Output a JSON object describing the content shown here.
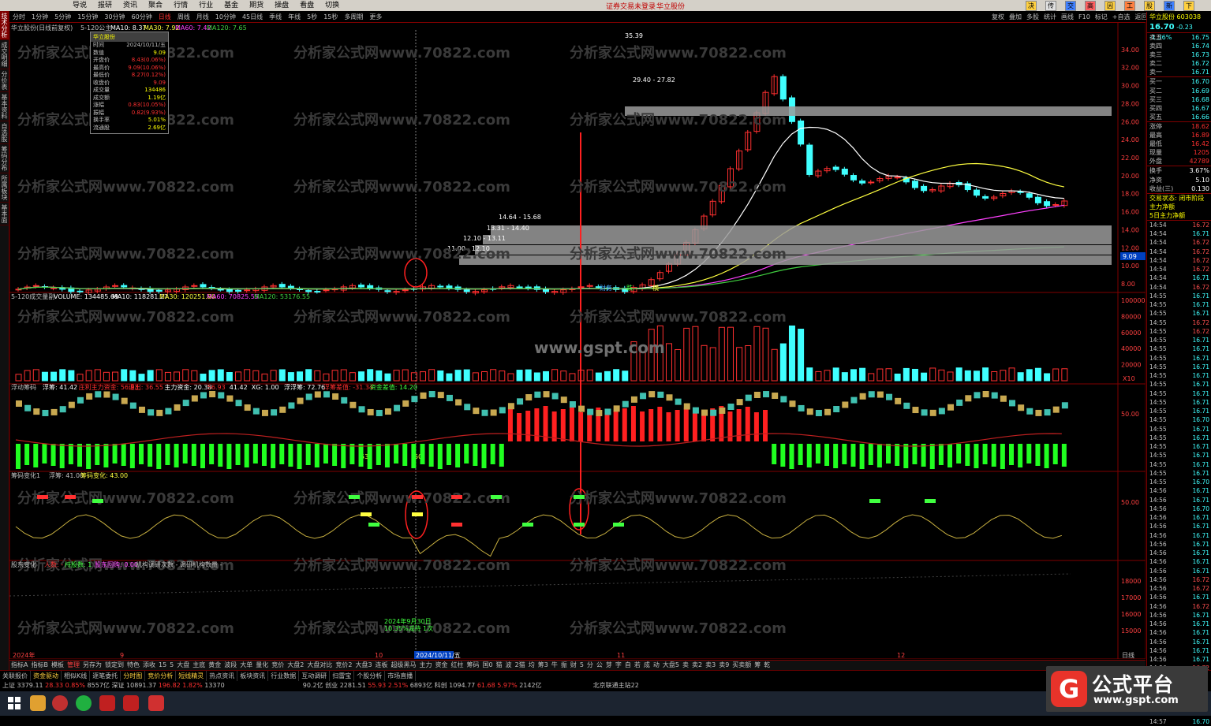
{
  "menu": {
    "items": [
      "分时",
      "1分钟",
      "5分钟",
      "15分钟",
      "30分钟",
      "60分钟",
      "日线",
      "周线",
      "月线",
      "10分钟",
      "45日线",
      "季线",
      "年线",
      "5秒",
      "15秒",
      "多周期",
      "更多"
    ],
    "top_items": [
      "导说",
      "报研",
      "资讯",
      "聚合",
      "行情",
      "行业",
      "基金",
      "期货",
      "操盘",
      "看盘",
      "切换"
    ],
    "notice1": "证券交易未登录",
    "notice2": "华立股份",
    "right_buttons": [
      "决策",
      "传统",
      "交易",
      "高点",
      "因子",
      "工具",
      "股池",
      "新面",
      "下页"
    ]
  },
  "right_tools": [
    "复权",
    "叠加",
    "多股",
    "统计",
    "画线",
    "F10",
    "标记",
    "+自选",
    "返回"
  ],
  "vtabs": [
    "技术分析",
    "成交明细",
    "分价表",
    "基本资料",
    "自选股",
    "筹码分布",
    "所属板块",
    "基本面"
  ],
  "main_chart": {
    "title": "华立股份(日线前复权)",
    "indicator": "5-120公主",
    "ma10": "MA10: 8.37",
    "ma30": "MA30: 7.92",
    "ma60": "MA60: 7.42",
    "ma120": "MA120: 7.65",
    "y_axis": [
      "34.00",
      "32.00",
      "30.00",
      "28.00",
      "26.00",
      "24.00",
      "22.00",
      "20.00",
      "18.00",
      "16.00",
      "14.00",
      "12.00",
      "10.00",
      "8.00"
    ],
    "annotations": {
      "high": "35.39",
      "band1": "29.40 - 27.82",
      "band2": "14.64 - 15.68",
      "band3": "13.31 - 14.40",
      "band4": "12.10 - 13.11",
      "band5": "11.00 - 12.10",
      "price_tag": "9.09"
    },
    "markers": [
      "财务",
      "跌",
      "横"
    ]
  },
  "infobox": {
    "title": "华立股份",
    "rows": [
      [
        "时间",
        "2024/10/11/五"
      ],
      [
        "数值",
        "9.09"
      ],
      [
        "开盘价",
        "8.43(0.06%)"
      ],
      [
        "最高价",
        "9.09(10.06%)"
      ],
      [
        "最低价",
        "8.27(0.12%)"
      ],
      [
        "收盘价",
        "9.09"
      ],
      [
        "成交量",
        "134486"
      ],
      [
        "成交额",
        "1.19亿"
      ],
      [
        "涨幅",
        "0.83(10.05%)"
      ],
      [
        "振幅",
        "0.82(9.93%)"
      ],
      [
        "换手率",
        "5.01%"
      ],
      [
        "流通股",
        "2.69亿"
      ]
    ]
  },
  "volume_panel": {
    "title": "5-120成交量副",
    "volume": "VOLUME: 134485.69",
    "ma10": "MA10: 118281.27",
    "ma30": "MA30: 120251.80",
    "ma60": "MA60: 70825.55",
    "ma120": "MA120: 53176.55",
    "y_axis": [
      "100000",
      "80000",
      "60000",
      "40000",
      "20000"
    ],
    "unit": "X10",
    "watermark": "www.gspt.com"
  },
  "flow_panel": {
    "title": "浮动筹码",
    "items": [
      "浮筹: 41.42",
      "庄利主力资金: 56.93",
      "退出: 36.55",
      "主力资金: 20.38",
      "56.93",
      "41.42",
      "XG: 1.00",
      "浮浮筹: 72.76",
      "浮筹差值: -31.34",
      "资金差值: 14.20"
    ],
    "y_label": "50.00",
    "low_labels": [
      "53",
      "50"
    ]
  },
  "chip_panel": {
    "title": "筹码变化1",
    "items": [
      "浮筹: 41.00",
      "筹码变化: 43.00"
    ],
    "y_label": "50.00"
  },
  "holder_panel": {
    "title": "股东变化",
    "items": [
      "人数: -",
      "持股数: 1",
      "股东回购: 0.00",
      "机构调研次数 - 调研机构数量 -"
    ],
    "y_axis": [
      "18000",
      "17000",
      "16000",
      "15000"
    ],
    "annotation1": "2024年9月30日",
    "annotation2": "10.35%减持 1次"
  },
  "date_axis": {
    "left": "2024年",
    "m9": "9",
    "m10": "10",
    "cursor": "2024/10/11/五",
    "m11": "11",
    "m12": "12",
    "period": "日线"
  },
  "watermark": "分析家公式网www.70822.com",
  "quote": {
    "name": "华立股份",
    "code": "603038",
    "price": "16.70",
    "change": "-0.23",
    "pct": "-1.36%",
    "asks": [
      [
        "卖五",
        "16.75",
        "15"
      ],
      [
        "卖四",
        "16.74",
        "3"
      ],
      [
        "卖三",
        "16.73",
        "28"
      ],
      [
        "卖二",
        "16.72",
        "12"
      ],
      [
        "卖一",
        "16.71",
        "37"
      ]
    ],
    "bids": [
      [
        "买一",
        "16.70",
        "84"
      ],
      [
        "买二",
        "16.69",
        "53"
      ],
      [
        "买三",
        "16.68",
        "35"
      ],
      [
        "买四",
        "16.67",
        "96"
      ],
      [
        "买五",
        "16.66",
        "2"
      ]
    ],
    "stats": [
      [
        "涨停",
        "18.62"
      ],
      [
        "最高",
        "16.89"
      ],
      [
        "最低",
        "16.42"
      ],
      [
        "现量",
        "1205"
      ],
      [
        "外盘",
        "42789"
      ]
    ],
    "stats2": [
      [
        "换手",
        "3.67%"
      ],
      [
        "净资",
        "5.10"
      ],
      [
        "收益(三)",
        "0.130"
      ]
    ],
    "trade_status": "交易状态: 闭市阶段",
    "main_net": "主力净额",
    "main_net5": "5日主力净额",
    "ticks": [
      [
        "14:54",
        "16.72"
      ],
      [
        "14:54",
        "16.71"
      ],
      [
        "14:54",
        "16.72"
      ],
      [
        "14:54",
        "16.72"
      ],
      [
        "14:54",
        "16.72"
      ],
      [
        "14:54",
        "16.72"
      ],
      [
        "14:54",
        "16.71"
      ],
      [
        "14:54",
        "16.72"
      ],
      [
        "14:55",
        "16.71"
      ],
      [
        "14:55",
        "16.71"
      ],
      [
        "14:55",
        "16.71"
      ],
      [
        "14:55",
        "16.72"
      ],
      [
        "14:55",
        "16.72"
      ],
      [
        "14:55",
        "16.71"
      ],
      [
        "14:55",
        "16.71"
      ],
      [
        "14:55",
        "16.71"
      ],
      [
        "14:55",
        "16.71"
      ],
      [
        "14:55",
        "16.71"
      ],
      [
        "14:55",
        "16.71"
      ],
      [
        "14:55",
        "16.71"
      ],
      [
        "14:55",
        "16.71"
      ],
      [
        "14:55",
        "16.71"
      ],
      [
        "14:55",
        "16.70"
      ],
      [
        "14:55",
        "16.71"
      ],
      [
        "14:55",
        "16.71"
      ],
      [
        "14:55",
        "16.71"
      ],
      [
        "14:55",
        "16.71"
      ],
      [
        "14:55",
        "16.71"
      ],
      [
        "14:55",
        "16.71"
      ],
      [
        "14:55",
        "16.70"
      ],
      [
        "14:56",
        "16.71"
      ],
      [
        "14:56",
        "16.71"
      ],
      [
        "14:56",
        "16.70"
      ],
      [
        "14:56",
        "16.71"
      ],
      [
        "14:56",
        "16.71"
      ],
      [
        "14:56",
        "16.71"
      ],
      [
        "14:56",
        "16.71"
      ],
      [
        "14:56",
        "16.71"
      ],
      [
        "14:56",
        "16.71"
      ],
      [
        "14:56",
        "16.71"
      ],
      [
        "14:56",
        "16.72"
      ],
      [
        "14:56",
        "16.72"
      ],
      [
        "14:56",
        "16.71"
      ],
      [
        "14:56",
        "16.72"
      ],
      [
        "14:56",
        "16.71"
      ],
      [
        "14:56",
        "16.71"
      ],
      [
        "14:56",
        "16.71"
      ],
      [
        "14:56",
        "16.71"
      ],
      [
        "14:56",
        "16.71"
      ],
      [
        "14:56",
        "16.71"
      ],
      [
        "14:56",
        "16.72"
      ],
      [
        "14:56",
        "16.71"
      ],
      [
        "14:56",
        "16.71"
      ],
      [
        "14:56",
        "16.71"
      ],
      [
        "14:56",
        "16.71"
      ],
      [
        "14:57",
        "16.71"
      ],
      [
        "14:57",
        "16.70"
      ]
    ]
  },
  "bottom_tabs1": [
    "指标A",
    "指标B",
    "模板",
    "管理",
    "另存为",
    "锁定到",
    "特色",
    "添收",
    "15",
    "5",
    "大盘",
    "主底",
    "黄金",
    "波段",
    "大单",
    "量化",
    "竞价",
    "大盘2",
    "大盘对比",
    "竞价2",
    "大盘3",
    "连板",
    "超级黑马",
    "主力",
    "资金",
    "红柱",
    "筹码",
    "国0",
    "猫",
    "波",
    "2猫",
    "均",
    "筹3",
    "牛",
    "振",
    "财",
    "5",
    "分",
    "公",
    "芽",
    "字",
    "自",
    "若",
    "成",
    "动",
    "大盘5",
    "卖",
    "卖2",
    "卖3",
    "卖9",
    "买卖额",
    "筹",
    "乾"
  ],
  "bottom_tabs2": [
    "关联报价",
    "资金驱动",
    "相似K线",
    "逐笔委托",
    "分时图",
    "竞价分析",
    "短线精灵",
    "热点资讯",
    "板块资讯",
    "行业数据",
    "互动调研",
    "扫雷宝",
    "个股分析",
    "市场直播"
  ],
  "status": {
    "sh": "上证 3379.11",
    "sh_chg": "28.33 0.85%",
    "sh_amt": "8557亿",
    "sz": "深证 10891.37",
    "sz_chg": "196.82 1.82%",
    "sz_amt": "13370",
    "cy": "创业 2281.51",
    "cy_chg": "55.93 2.51%",
    "cy_amt": "6893亿",
    "kc": "科创 1094.77",
    "kc_chg": "61.68 5.97%",
    "kc_amt": "2142亿",
    "server": "北京联通主站22",
    "partial": "90.2亿"
  },
  "logo": {
    "mark": "G",
    "title": "公式平台",
    "url": "www.gspt.com"
  },
  "colors": {
    "up": "#ff3030",
    "down": "#40ffff",
    "ma10": "#ffffff",
    "ma30": "#ffff40",
    "ma60": "#ff40ff",
    "ma120": "#40d040",
    "green": "#00ff00",
    "accent": "#e8332a"
  }
}
